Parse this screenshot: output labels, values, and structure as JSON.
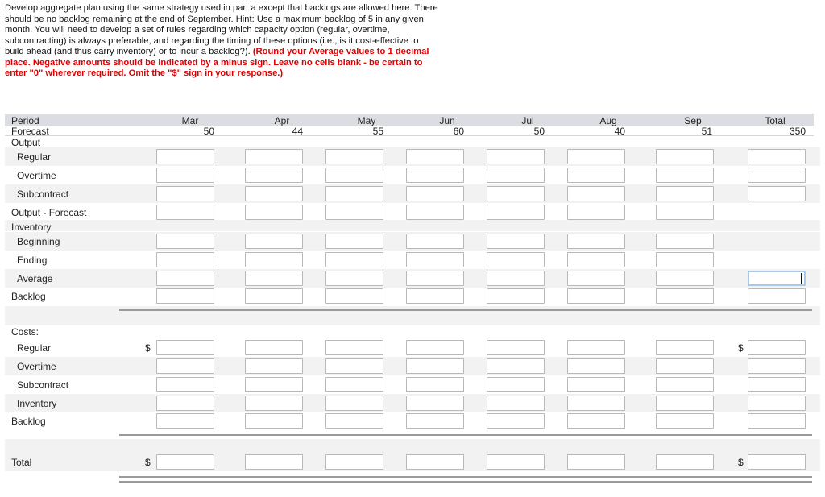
{
  "instructions": {
    "text": "Develop aggregate plan using the same strategy used in part a except that backlogs are allowed here. There should be no backlog remaining at the end of September. Hint: Use a maximum backlog of 5 in any given month. You will need to develop a set of rules regarding which capacity option (regular, overtime, subcontracting) is always preferable, and regarding the timing of these options (i.e., is it cost-effective to build ahead (and thus carry inventory) or to incur a backlog?). ",
    "emphasis": "(Round your Average values to 1 decimal place. Negative amounts should be indicated by a minus sign. Leave no cells blank - be certain to enter \"0\" wherever required. Omit the \"$\" sign in your response.)"
  },
  "table": {
    "period_label": "Period",
    "forecast_label": "Forecast",
    "months": [
      "Mar",
      "Apr",
      "May",
      "Jun",
      "Jul",
      "Aug",
      "Sep",
      "Total"
    ],
    "forecast": [
      "50",
      "44",
      "55",
      "60",
      "50",
      "40",
      "51",
      "350"
    ],
    "rows": {
      "output": "Output",
      "regular": "Regular",
      "overtime": "Overtime",
      "subcontract": "Subcontract",
      "output_forecast": "Output - Forecast",
      "inventory": "Inventory",
      "beginning": "Beginning",
      "ending": "Ending",
      "average": "Average",
      "backlog": "Backlog"
    },
    "costs": {
      "header": "Costs:",
      "regular": "Regular",
      "overtime": "Overtime",
      "subcontract": "Subcontract",
      "inventory": "Inventory",
      "backlog": "Backlog",
      "total": "Total"
    },
    "currency_symbol": "$"
  }
}
